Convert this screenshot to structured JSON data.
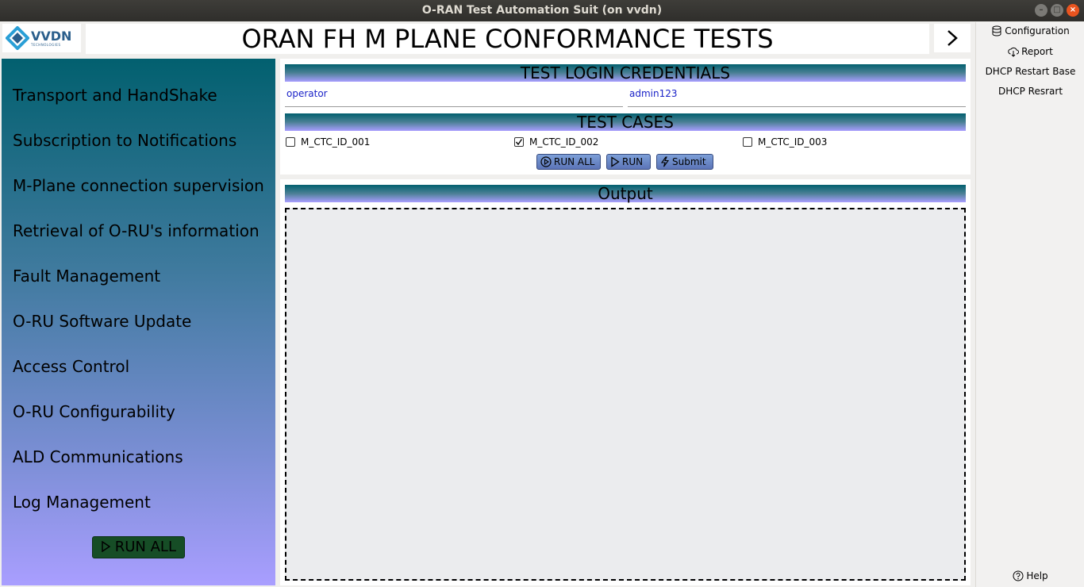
{
  "window": {
    "title": "O-RAN Test Automation Suit (on vvdn)"
  },
  "header": {
    "logo_name": "VVDN",
    "logo_sub": "TECHNOLOGIES",
    "title": "ORAN FH M PLANE CONFORMANCE TESTS",
    "next_arrow": "›"
  },
  "sidebar": {
    "items": [
      {
        "label": "Transport and HandShake"
      },
      {
        "label": "Subscription to Notifications"
      },
      {
        "label": "M-Plane connection supervision"
      },
      {
        "label": "Retrieval of O-RU's information"
      },
      {
        "label": "Fault Management"
      },
      {
        "label": "O-RU Software Update"
      },
      {
        "label": "Access Control"
      },
      {
        "label": "O-RU Configurability"
      },
      {
        "label": "ALD Communications"
      },
      {
        "label": "Log Management"
      }
    ],
    "run_all_label": "RUN ALL"
  },
  "credentials": {
    "heading": "TEST LOGIN CREDENTIALS",
    "username": "operator",
    "password": "admin123"
  },
  "test_cases": {
    "heading": "TEST CASES",
    "items": [
      {
        "label": "M_CTC_ID_001",
        "checked": false
      },
      {
        "label": "M_CTC_ID_002",
        "checked": true
      },
      {
        "label": "M_CTC_ID_003",
        "checked": false
      }
    ],
    "run_all_label": "RUN ALL",
    "run_label": "RUN",
    "submit_label": "Submit"
  },
  "output": {
    "heading": "Output"
  },
  "right_menu": {
    "configuration": "Configuration",
    "report": "Report",
    "dhcp_restart_base": "DHCP Restart Base",
    "dhcp_resrart": "DHCP Resrart",
    "help": "Help"
  },
  "colors": {
    "sidebar_top": "#02606f",
    "sidebar_bottom": "#a99eff",
    "field_text": "#1a22c8",
    "run_all_green": "#164d26"
  }
}
